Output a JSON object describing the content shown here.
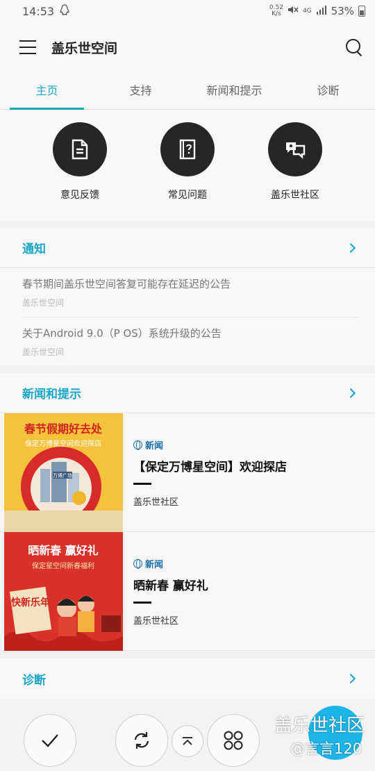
{
  "status": {
    "time": "14:53",
    "net_speed_top": "0.52",
    "net_speed_bottom": "K/s",
    "network": "4G",
    "battery": "53%"
  },
  "appbar": {
    "title": "盖乐世空间"
  },
  "tabs": [
    "主页",
    "支持",
    "新闻和提示",
    "诊断"
  ],
  "quick_actions": [
    {
      "label": "意见反馈",
      "icon": "document-icon"
    },
    {
      "label": "常见问题",
      "icon": "question-book-icon"
    },
    {
      "label": "盖乐世社区",
      "icon": "community-chat-icon"
    }
  ],
  "notices": {
    "title": "通知",
    "items": [
      {
        "title": "春节期间盖乐世空间答复可能存在延迟的公告",
        "source": "盖乐世空间"
      },
      {
        "title": "关于Android 9.0（P OS）系统升级的公告",
        "source": "盖乐世空间"
      }
    ]
  },
  "news": {
    "title": "新闻和提示",
    "items": [
      {
        "tag": "新闻",
        "title": "【保定万博星空间】欢迎探店",
        "source": "盖乐世社区",
        "thumb_line1": "春节假期好去处",
        "thumb_line2": "保定万博星空间欢迎探店",
        "thumb_sign": "万博广场"
      },
      {
        "tag": "新闻",
        "title": "晒新春 赢好礼",
        "source": "盖乐世社区",
        "thumb_line1": "晒新春 赢好礼",
        "thumb_line2": "保定星空间新春福利",
        "thumb_sign": "快新乐年"
      }
    ]
  },
  "diagnosis": {
    "title": "诊断"
  },
  "watermark": {
    "line1": "盖乐世社区",
    "line2": "@言言120"
  },
  "colors": {
    "accent": "#1aa6c9",
    "dark_circle": "#262626",
    "fab": "#1db5e8"
  }
}
